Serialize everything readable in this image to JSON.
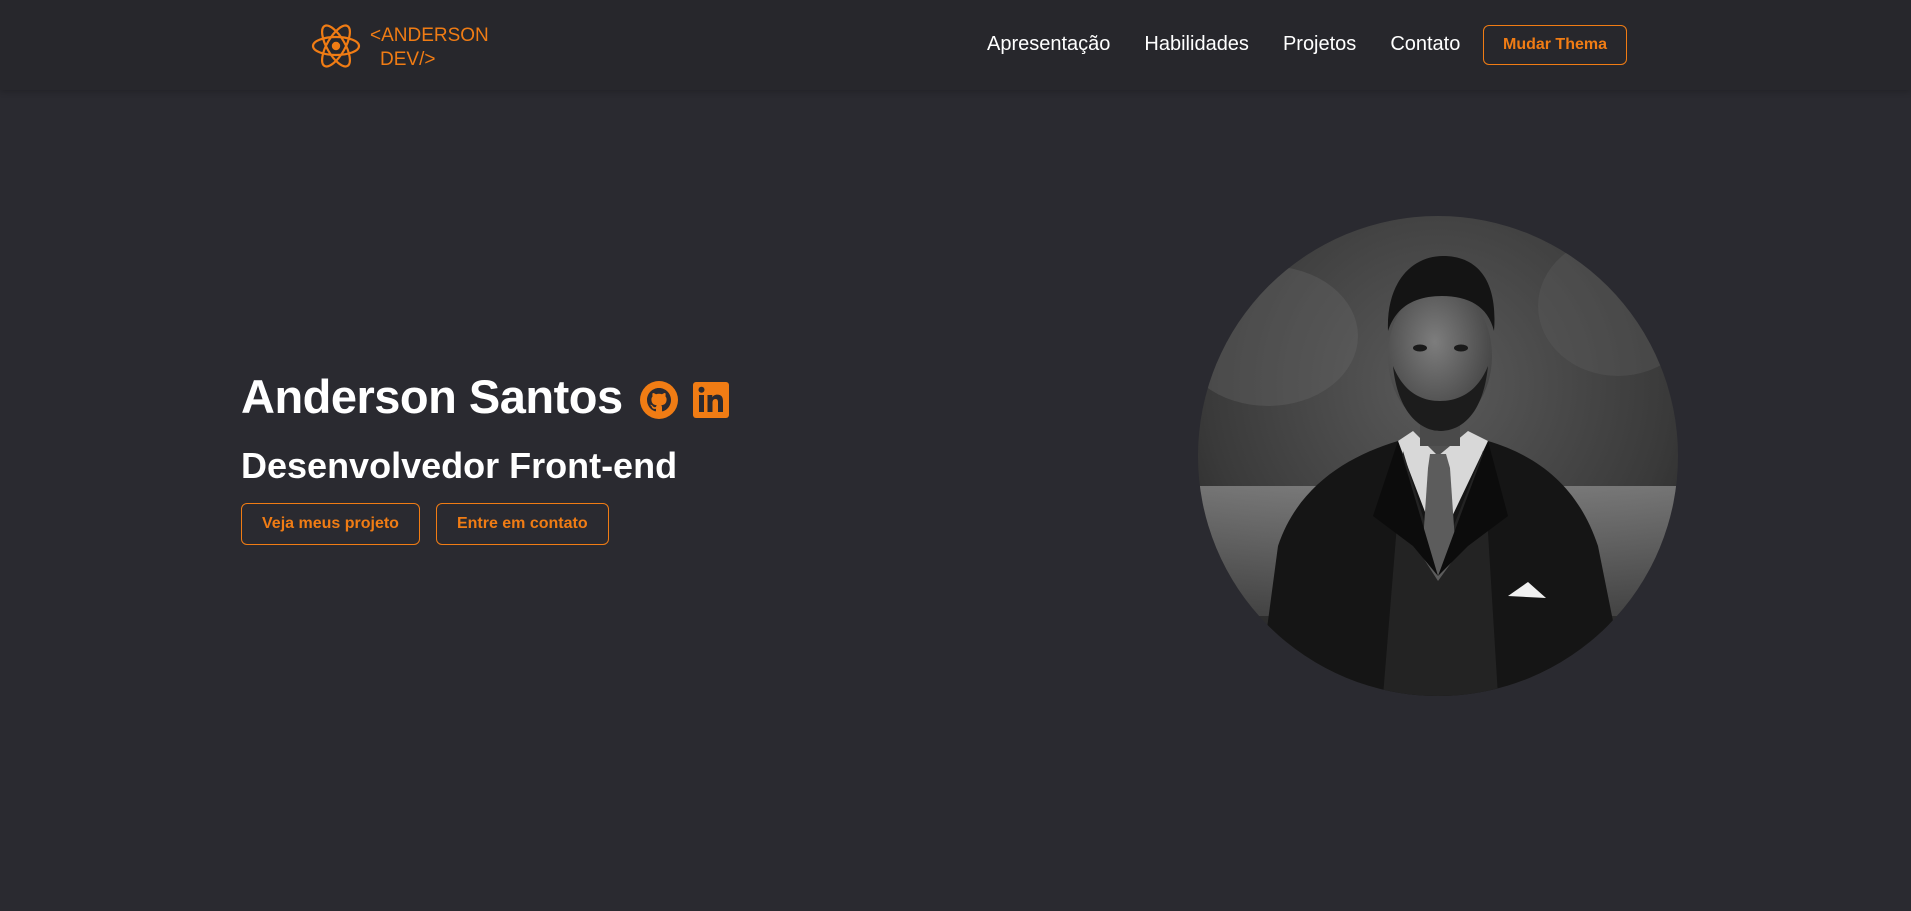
{
  "header": {
    "logo": {
      "line1": "<ANDERSON",
      "line2": "DEV/>",
      "icon": "react-atom-icon"
    },
    "nav": [
      {
        "label": "Apresentação"
      },
      {
        "label": "Habilidades"
      },
      {
        "label": "Projetos"
      },
      {
        "label": "Contato"
      }
    ],
    "theme_button": "Mudar Thema"
  },
  "hero": {
    "name": "Anderson Santos",
    "subtitle": "Desenvolvedor Front-end",
    "social": [
      {
        "icon": "github-icon"
      },
      {
        "icon": "linkedin-icon"
      }
    ],
    "buttons": [
      {
        "label": "Veja meus projeto"
      },
      {
        "label": "Entre em contato"
      }
    ],
    "photo": {
      "icon": "profile-photo"
    }
  },
  "colors": {
    "accent": "#f07c14",
    "background": "#2a2a30",
    "navbar": "#27272c",
    "text": "#ffffff"
  }
}
